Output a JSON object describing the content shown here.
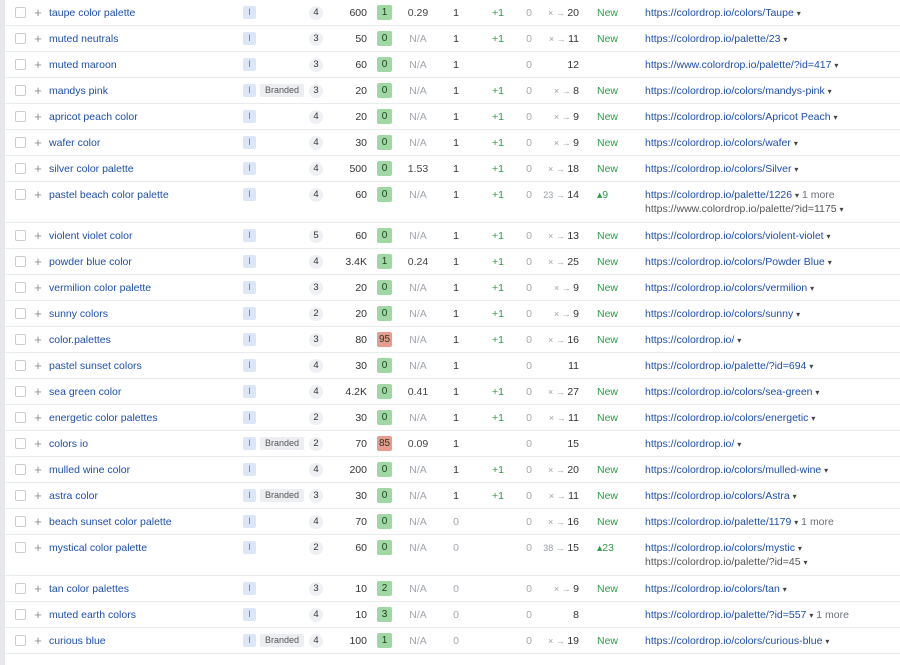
{
  "colors": {
    "kd_green": "#9fd8a3",
    "kd_red": "#e89b91",
    "link": "#1f4fa8",
    "new_green": "#2e9b48"
  },
  "rows": [
    {
      "kw": "taupe color palette",
      "intent": "I",
      "branded": "",
      "kd": "4",
      "vol": "600",
      "score": "1",
      "score_color": "green",
      "cpc": "0.29",
      "pos": "1",
      "chg": "+1",
      "zero": "0",
      "mv_arrow": "× →",
      "mv_to": "20",
      "st": "New",
      "url": "https://colordrop.io/colors/Taupe ",
      "caret": "▾",
      "more": "",
      "url2": ""
    },
    {
      "kw": "muted neutrals",
      "intent": "I",
      "branded": "",
      "kd": "3",
      "vol": "50",
      "score": "0",
      "score_color": "green",
      "cpc": "N/A",
      "pos": "1",
      "chg": "+1",
      "zero": "0",
      "mv_arrow": "× →",
      "mv_to": "11",
      "st": "New",
      "url": "https://colordrop.io/palette/23 ",
      "caret": "▾",
      "more": "",
      "url2": ""
    },
    {
      "kw": "muted maroon",
      "intent": "I",
      "branded": "",
      "kd": "3",
      "vol": "60",
      "score": "0",
      "score_color": "green",
      "cpc": "N/A",
      "pos": "1",
      "chg": "",
      "zero": "0",
      "mv_arrow": "",
      "mv_to": "12",
      "st": "",
      "url": "https://www.colordrop.io/palette/?id=417 ",
      "caret": "▾",
      "more": "",
      "url2": ""
    },
    {
      "kw": "mandys pink",
      "intent": "I",
      "branded": "Branded",
      "kd": "3",
      "vol": "20",
      "score": "0",
      "score_color": "green",
      "cpc": "N/A",
      "pos": "1",
      "chg": "+1",
      "zero": "0",
      "mv_arrow": "× →",
      "mv_to": "8",
      "st": "New",
      "url": "https://colordrop.io/colors/mandys-pink ",
      "caret": "▾",
      "more": "",
      "url2": ""
    },
    {
      "kw": "apricot peach color",
      "intent": "I",
      "branded": "",
      "kd": "4",
      "vol": "20",
      "score": "0",
      "score_color": "green",
      "cpc": "N/A",
      "pos": "1",
      "chg": "+1",
      "zero": "0",
      "mv_arrow": "× →",
      "mv_to": "9",
      "st": "New",
      "url": "https://colordrop.io/colors/Apricot Peach ",
      "caret": "▾",
      "more": "",
      "url2": ""
    },
    {
      "kw": "wafer color",
      "intent": "I",
      "branded": "",
      "kd": "4",
      "vol": "30",
      "score": "0",
      "score_color": "green",
      "cpc": "N/A",
      "pos": "1",
      "chg": "+1",
      "zero": "0",
      "mv_arrow": "× →",
      "mv_to": "9",
      "st": "New",
      "url": "https://colordrop.io/colors/wafer ",
      "caret": "▾",
      "more": "",
      "url2": ""
    },
    {
      "kw": "silver color palette",
      "intent": "I",
      "branded": "",
      "kd": "4",
      "vol": "500",
      "score": "0",
      "score_color": "green",
      "cpc": "1.53",
      "pos": "1",
      "chg": "+1",
      "zero": "0",
      "mv_arrow": "× →",
      "mv_to": "18",
      "st": "New",
      "url": "https://colordrop.io/colors/Silver ",
      "caret": "▾",
      "more": "",
      "url2": ""
    },
    {
      "kw": "pastel beach color palette",
      "intent": "I",
      "branded": "",
      "kd": "4",
      "vol": "60",
      "score": "0",
      "score_color": "green",
      "cpc": "N/A",
      "pos": "1",
      "chg": "+1",
      "zero": "0",
      "mv_arrow": "23 →",
      "mv_to": "14",
      "st": "▴9",
      "url": "https://colordrop.io/palette/1226 ",
      "caret": "▾",
      "more": "1 more",
      "url2": "https://www.colordrop.io/palette/?id=1175 "
    },
    {
      "kw": "violent violet color",
      "intent": "I",
      "branded": "",
      "kd": "5",
      "vol": "60",
      "score": "0",
      "score_color": "green",
      "cpc": "N/A",
      "pos": "1",
      "chg": "+1",
      "zero": "0",
      "mv_arrow": "× →",
      "mv_to": "13",
      "st": "New",
      "url": "https://colordrop.io/colors/violent-violet ",
      "caret": "▾",
      "more": "",
      "url2": ""
    },
    {
      "kw": "powder blue color",
      "intent": "I",
      "branded": "",
      "kd": "4",
      "vol": "3.4K",
      "score": "1",
      "score_color": "green",
      "cpc": "0.24",
      "pos": "1",
      "chg": "+1",
      "zero": "0",
      "mv_arrow": "× →",
      "mv_to": "25",
      "st": "New",
      "url": "https://colordrop.io/colors/Powder Blue ",
      "caret": "▾",
      "more": "",
      "url2": ""
    },
    {
      "kw": "vermilion color palette",
      "intent": "I",
      "branded": "",
      "kd": "3",
      "vol": "20",
      "score": "0",
      "score_color": "green",
      "cpc": "N/A",
      "pos": "1",
      "chg": "+1",
      "zero": "0",
      "mv_arrow": "× →",
      "mv_to": "9",
      "st": "New",
      "url": "https://colordrop.io/colors/vermilion ",
      "caret": "▾",
      "more": "",
      "url2": ""
    },
    {
      "kw": "sunny colors",
      "intent": "I",
      "branded": "",
      "kd": "2",
      "vol": "20",
      "score": "0",
      "score_color": "green",
      "cpc": "N/A",
      "pos": "1",
      "chg": "+1",
      "zero": "0",
      "mv_arrow": "× →",
      "mv_to": "9",
      "st": "New",
      "url": "https://colordrop.io/colors/sunny ",
      "caret": "▾",
      "more": "",
      "url2": ""
    },
    {
      "kw": "color.palettes",
      "intent": "I",
      "branded": "",
      "kd": "3",
      "vol": "80",
      "score": "95",
      "score_color": "red",
      "cpc": "N/A",
      "pos": "1",
      "chg": "+1",
      "zero": "0",
      "mv_arrow": "× →",
      "mv_to": "16",
      "st": "New",
      "url": "https://colordrop.io/ ",
      "caret": "▾",
      "more": "",
      "url2": ""
    },
    {
      "kw": "pastel sunset colors",
      "intent": "I",
      "branded": "",
      "kd": "4",
      "vol": "30",
      "score": "0",
      "score_color": "green",
      "cpc": "N/A",
      "pos": "1",
      "chg": "",
      "zero": "0",
      "mv_arrow": "",
      "mv_to": "11",
      "st": "",
      "url": "https://colordrop.io/palette/?id=694 ",
      "caret": "▾",
      "more": "",
      "url2": ""
    },
    {
      "kw": "sea green color",
      "intent": "I",
      "branded": "",
      "kd": "4",
      "vol": "4.2K",
      "score": "0",
      "score_color": "green",
      "cpc": "0.41",
      "pos": "1",
      "chg": "+1",
      "zero": "0",
      "mv_arrow": "× →",
      "mv_to": "27",
      "st": "New",
      "url": "https://colordrop.io/colors/sea-green ",
      "caret": "▾",
      "more": "",
      "url2": ""
    },
    {
      "kw": "energetic color palettes",
      "intent": "I",
      "branded": "",
      "kd": "2",
      "vol": "30",
      "score": "0",
      "score_color": "green",
      "cpc": "N/A",
      "pos": "1",
      "chg": "+1",
      "zero": "0",
      "mv_arrow": "× →",
      "mv_to": "11",
      "st": "New",
      "url": "https://colordrop.io/colors/energetic ",
      "caret": "▾",
      "more": "",
      "url2": ""
    },
    {
      "kw": "colors io",
      "intent": "I",
      "branded": "Branded",
      "kd": "2",
      "vol": "70",
      "score": "85",
      "score_color": "red",
      "cpc": "0.09",
      "pos": "1",
      "chg": "",
      "zero": "0",
      "mv_arrow": "",
      "mv_to": "15",
      "st": "",
      "url": "https://colordrop.io/ ",
      "caret": "▾",
      "more": "",
      "url2": ""
    },
    {
      "kw": "mulled wine color",
      "intent": "I",
      "branded": "",
      "kd": "4",
      "vol": "200",
      "score": "0",
      "score_color": "green",
      "cpc": "N/A",
      "pos": "1",
      "chg": "+1",
      "zero": "0",
      "mv_arrow": "× →",
      "mv_to": "20",
      "st": "New",
      "url": "https://colordrop.io/colors/mulled-wine ",
      "caret": "▾",
      "more": "",
      "url2": ""
    },
    {
      "kw": "astra color",
      "intent": "I",
      "branded": "Branded",
      "kd": "3",
      "vol": "30",
      "score": "0",
      "score_color": "green",
      "cpc": "N/A",
      "pos": "1",
      "chg": "+1",
      "zero": "0",
      "mv_arrow": "× →",
      "mv_to": "11",
      "st": "New",
      "url": "https://colordrop.io/colors/Astra ",
      "caret": "▾",
      "more": "",
      "url2": ""
    },
    {
      "kw": "beach sunset color palette",
      "intent": "I",
      "branded": "",
      "kd": "4",
      "vol": "70",
      "score": "0",
      "score_color": "green",
      "cpc": "N/A",
      "pos": "",
      "pos_zero": "0",
      "chg": "",
      "zero": "0",
      "mv_arrow": "× →",
      "mv_to": "16",
      "st": "New",
      "url": "https://colordrop.io/palette/1179 ",
      "caret": "▾",
      "more": "1 more",
      "url2": ""
    },
    {
      "kw": "mystical color palette",
      "intent": "I",
      "branded": "",
      "kd": "2",
      "vol": "60",
      "score": "0",
      "score_color": "green",
      "cpc": "N/A",
      "pos": "",
      "pos_zero": "0",
      "chg": "",
      "zero": "0",
      "mv_arrow": "38 →",
      "mv_to": "15",
      "st": "▴23",
      "url": "https://colordrop.io/colors/mystic ",
      "caret": "▾",
      "more": "",
      "url2": "https://colordrop.io/palette/?id=45 "
    },
    {
      "kw": "tan color palettes",
      "intent": "I",
      "branded": "",
      "kd": "3",
      "vol": "10",
      "score": "2",
      "score_color": "green",
      "cpc": "N/A",
      "pos": "",
      "pos_zero": "0",
      "chg": "",
      "zero": "0",
      "mv_arrow": "× →",
      "mv_to": "9",
      "st": "New",
      "url": "https://colordrop.io/colors/tan ",
      "caret": "▾",
      "more": "",
      "url2": ""
    },
    {
      "kw": "muted earth colors",
      "intent": "I",
      "branded": "",
      "kd": "4",
      "vol": "10",
      "score": "3",
      "score_color": "green",
      "cpc": "N/A",
      "pos": "",
      "pos_zero": "0",
      "chg": "",
      "zero": "0",
      "mv_arrow": "",
      "mv_to": "8",
      "st": "",
      "url": "https://colordrop.io/palette/?id=557 ",
      "caret": "▾",
      "more": "1 more",
      "url2": ""
    },
    {
      "kw": "curious blue",
      "intent": "I",
      "branded": "Branded",
      "kd": "4",
      "vol": "100",
      "score": "1",
      "score_color": "green",
      "cpc": "N/A",
      "pos": "",
      "pos_zero": "0",
      "chg": "",
      "zero": "0",
      "mv_arrow": "× →",
      "mv_to": "19",
      "st": "New",
      "url": "https://colordrop.io/colors/curious-blue ",
      "caret": "▾",
      "more": "",
      "url2": ""
    }
  ]
}
